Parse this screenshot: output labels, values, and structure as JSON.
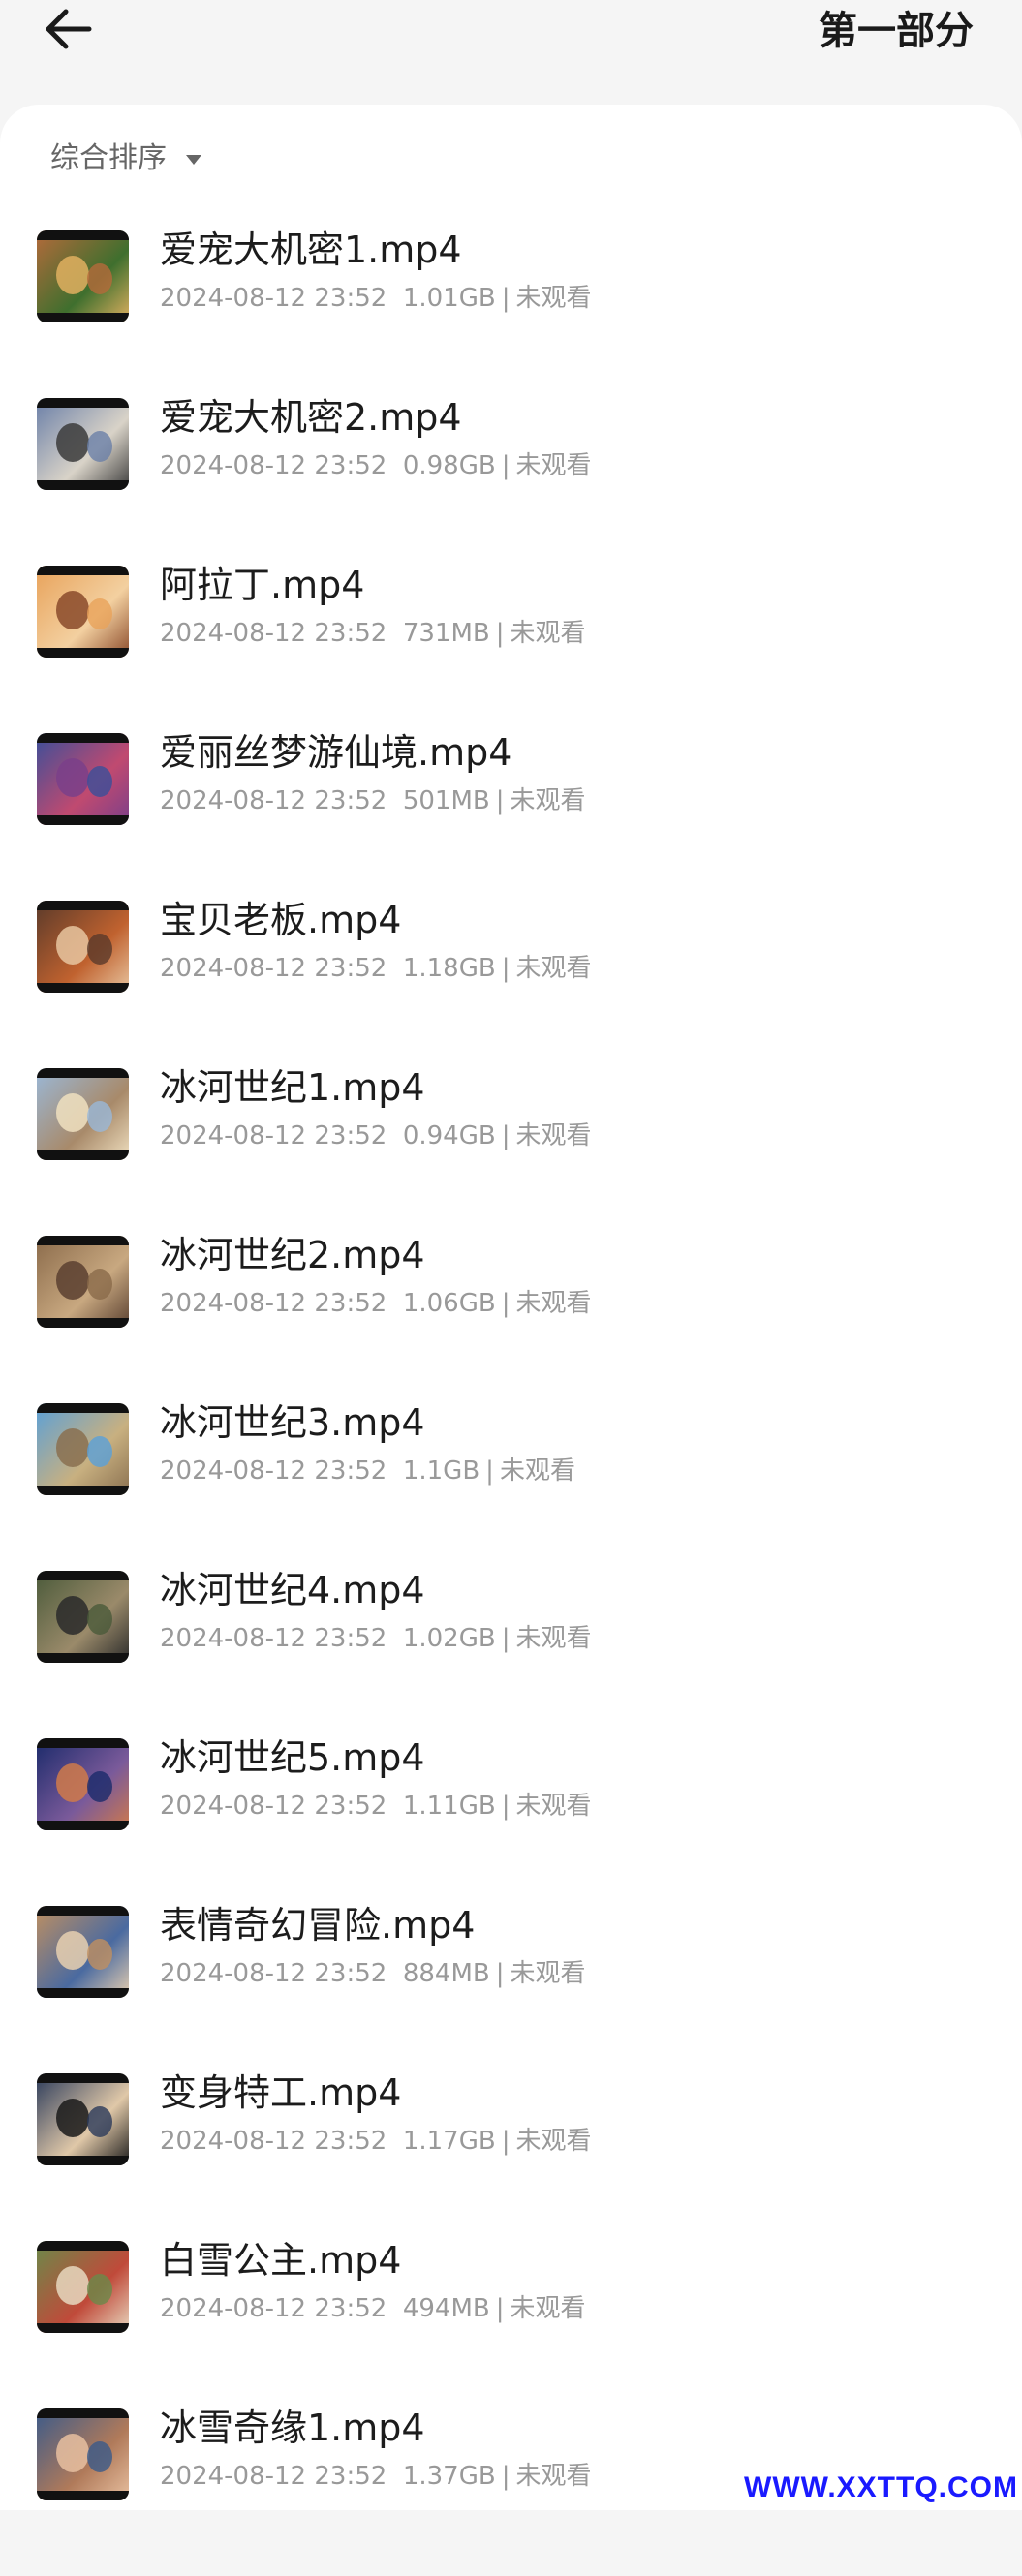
{
  "header": {
    "title": "第一部分",
    "back_icon": "arrow-left-icon"
  },
  "sort": {
    "label": "综合排序",
    "icon": "caret-down-icon"
  },
  "files": [
    {
      "name": "爱宠大机密1.mp4",
      "date": "2024-08-12 23:52",
      "size": "1.01GB",
      "status": "未观看",
      "thumb_colors": [
        "#b56a3b",
        "#3f6f2e",
        "#e0b060"
      ]
    },
    {
      "name": "爱宠大机密2.mp4",
      "date": "2024-08-12 23:52",
      "size": "0.98GB",
      "status": "未观看",
      "thumb_colors": [
        "#6a7fa8",
        "#d9d3c8",
        "#3b3b3b"
      ]
    },
    {
      "name": "阿拉丁.mp4",
      "date": "2024-08-12 23:52",
      "size": "731MB",
      "status": "未观看",
      "thumb_colors": [
        "#e8a25a",
        "#f3d0a0",
        "#8a4a2a"
      ]
    },
    {
      "name": "爱丽丝梦游仙境.mp4",
      "date": "2024-08-12 23:52",
      "size": "501MB",
      "status": "未观看",
      "thumb_colors": [
        "#3a4f9a",
        "#c04a70",
        "#7a3f8a"
      ]
    },
    {
      "name": "宝贝老板.mp4",
      "date": "2024-08-12 23:52",
      "size": "1.18GB",
      "status": "未观看",
      "thumb_colors": [
        "#5a3a2a",
        "#c0622f",
        "#e8c5a0"
      ]
    },
    {
      "name": "冰河世纪1.mp4",
      "date": "2024-08-12 23:52",
      "size": "0.94GB",
      "status": "未观看",
      "thumb_colors": [
        "#9ab8d8",
        "#a88a6a",
        "#f0e0c0"
      ]
    },
    {
      "name": "冰河世纪2.mp4",
      "date": "2024-08-12 23:52",
      "size": "1.06GB",
      "status": "未观看",
      "thumb_colors": [
        "#8a6a4a",
        "#c8a880",
        "#5a4030"
      ]
    },
    {
      "name": "冰河世纪3.mp4",
      "date": "2024-08-12 23:52",
      "size": "1.1GB",
      "status": "未观看",
      "thumb_colors": [
        "#5aa0d8",
        "#c8b080",
        "#8a7050"
      ]
    },
    {
      "name": "冰河世纪4.mp4",
      "date": "2024-08-12 23:52",
      "size": "1.02GB",
      "status": "未观看",
      "thumb_colors": [
        "#4a5a3a",
        "#9a8a6a",
        "#2a2a2a"
      ]
    },
    {
      "name": "冰河世纪5.mp4",
      "date": "2024-08-12 23:52",
      "size": "1.11GB",
      "status": "未观看",
      "thumb_colors": [
        "#1a2a6a",
        "#7a5a9a",
        "#d07a4a"
      ]
    },
    {
      "name": "表情奇幻冒险.mp4",
      "date": "2024-08-12 23:52",
      "size": "884MB",
      "status": "未观看",
      "thumb_colors": [
        "#c09060",
        "#4a6aa0",
        "#e8d0b0"
      ]
    },
    {
      "name": "变身特工.mp4",
      "date": "2024-08-12 23:52",
      "size": "1.17GB",
      "status": "未观看",
      "thumb_colors": [
        "#2a3a5a",
        "#e0c8a8",
        "#1a1a1a"
      ]
    },
    {
      "name": "白雪公主.mp4",
      "date": "2024-08-12 23:52",
      "size": "494MB",
      "status": "未观看",
      "thumb_colors": [
        "#6a8a4a",
        "#c04a3a",
        "#e8d8c0"
      ]
    },
    {
      "name": "冰雪奇缘1.mp4",
      "date": "2024-08-12 23:52",
      "size": "1.37GB",
      "status": "未观看",
      "thumb_colors": [
        "#3a5a8a",
        "#b07a5a",
        "#e8c0a0"
      ]
    }
  ],
  "watermark": "WWW.XXTTQ.COM"
}
